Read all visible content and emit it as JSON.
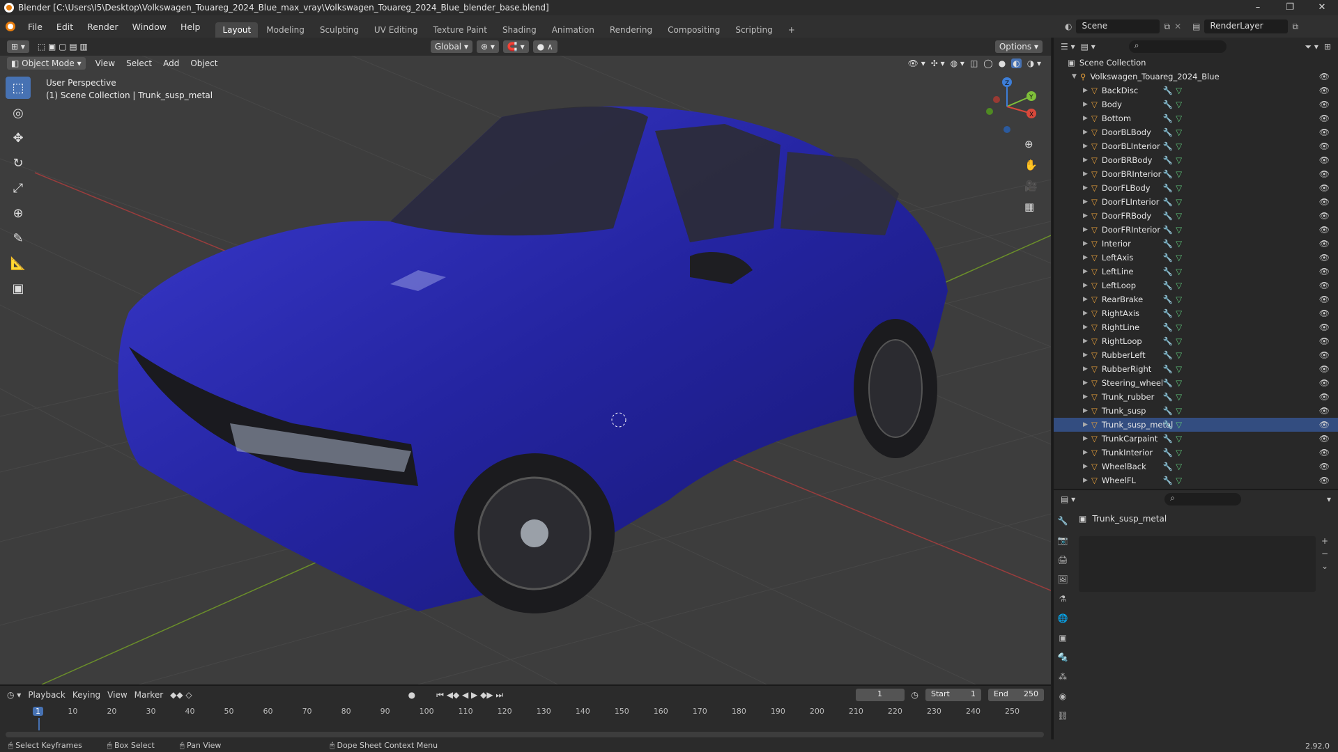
{
  "window": {
    "title": "Blender [C:\\Users\\I5\\Desktop\\Volkswagen_Touareg_2024_Blue_max_vray\\Volkswagen_Touareg_2024_Blue_blender_base.blend]",
    "controls": [
      "–",
      "❐",
      "✕"
    ]
  },
  "menu": [
    "File",
    "Edit",
    "Render",
    "Window",
    "Help"
  ],
  "workspaces": [
    "Layout",
    "Modeling",
    "Sculpting",
    "UV Editing",
    "Texture Paint",
    "Shading",
    "Animation",
    "Rendering",
    "Compositing",
    "Scripting"
  ],
  "active_workspace": "Layout",
  "scene": {
    "name": "Scene",
    "layer": "RenderLayer"
  },
  "viewport": {
    "mode": "Object Mode",
    "menus": [
      "View",
      "Select",
      "Add",
      "Object"
    ],
    "orientation": "Global",
    "options_label": "Options",
    "info_line1": "User Perspective",
    "info_line2": "(1) Scene Collection | Trunk_susp_metal",
    "gizmo": {
      "x": "X",
      "y": "Y",
      "z": "Z"
    }
  },
  "outliner": {
    "root": "Scene Collection",
    "collection": "Volkswagen_Touareg_2024_Blue",
    "items": [
      "BackDisc",
      "Body",
      "Bottom",
      "DoorBLBody",
      "DoorBLInterior",
      "DoorBRBody",
      "DoorBRInterior",
      "DoorFLBody",
      "DoorFLInterior",
      "DoorFRBody",
      "DoorFRInterior",
      "Interior",
      "LeftAxis",
      "LeftLine",
      "LeftLoop",
      "RearBrake",
      "RightAxis",
      "RightLine",
      "RightLoop",
      "RubberLeft",
      "RubberRight",
      "Steering_wheel",
      "Trunk_rubber",
      "Trunk_susp",
      "Trunk_susp_metal",
      "TrunkCarpaint",
      "TrunkInterior",
      "WheelBack",
      "WheelFL"
    ],
    "selected": "Trunk_susp_metal"
  },
  "properties": {
    "object_name": "Trunk_susp_metal"
  },
  "timeline": {
    "menus": [
      "Playback",
      "Keying",
      "View",
      "Marker"
    ],
    "current_frame": "1",
    "start_label": "Start",
    "start": "1",
    "end_label": "End",
    "end": "250",
    "ticks": [
      "1",
      "10",
      "20",
      "30",
      "40",
      "50",
      "60",
      "70",
      "80",
      "90",
      "100",
      "110",
      "120",
      "130",
      "140",
      "150",
      "160",
      "170",
      "180",
      "190",
      "200",
      "210",
      "220",
      "230",
      "240",
      "250"
    ]
  },
  "status": {
    "select": "Select Keyframes",
    "box": "Box Select",
    "pan": "Pan View",
    "context": "Dope Sheet Context Menu",
    "version": "2.92.0"
  },
  "colors": {
    "accent": "#4772b3",
    "car": "#2a2aa8",
    "orange": "#e87d0d"
  }
}
